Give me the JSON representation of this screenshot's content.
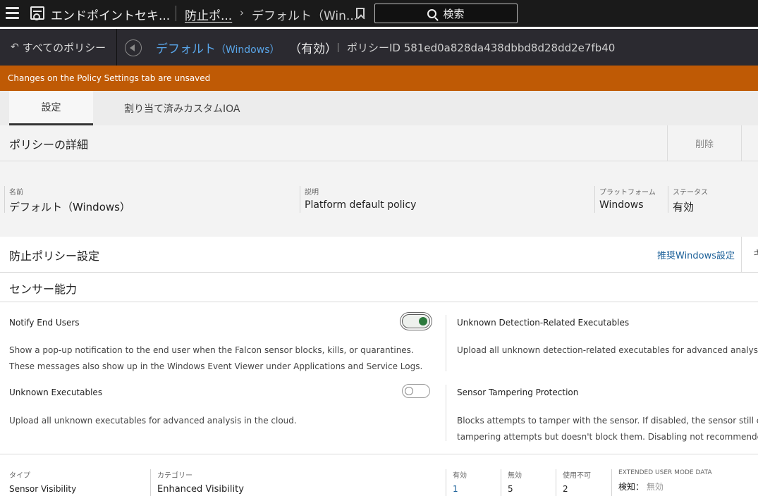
{
  "topbar": {
    "app_title": "エンドポイントセキ...",
    "crumb1": "防止ポ...",
    "crumb_chevron": "›",
    "crumb2": "デフォルト（Win...",
    "search_label": "検索"
  },
  "policy_bar": {
    "back_label": "すべてのポリシー",
    "undo_glyph": "↶",
    "name": "デフォルト",
    "platform": "（Windows）",
    "state": "（有効）",
    "id_label": "ポリシーID 581ed0a828da438dbbd8d28dd2e7fb40"
  },
  "banner": {
    "text": "Changes on the Policy Settings tab are unsaved"
  },
  "tabs": [
    {
      "label": "設定"
    },
    {
      "label": "割り当て済みカスタムIOA"
    }
  ],
  "details": {
    "title": "ポリシーの詳細",
    "delete_label": "削除",
    "fields": {
      "name_label": "名前",
      "name_value": "デフォルト（Windows）",
      "desc_label": "説明",
      "desc_value": "Platform default policy",
      "platform_label": "プラットフォーム",
      "platform_value": "Windows",
      "status_label": "ステータス",
      "status_value": "有効"
    }
  },
  "prevention": {
    "title": "防止ポリシー設定",
    "recommend_link": "推奨Windows設定",
    "extra": "キ"
  },
  "sensor": {
    "title": "センサー能力",
    "settings": [
      {
        "name": "Notify End Users",
        "desc1": "Show a pop-up notification to the end user when the Falcon sensor blocks, kills, or quarantines.",
        "desc2": "These messages also show up in the Windows Event Viewer under Applications and Service Logs.",
        "enabled": true
      },
      {
        "name": "Unknown Detection-Related Executables",
        "desc1": "Upload all unknown detection-related executables for advanced analysis"
      },
      {
        "name": "Unknown Executables",
        "desc1": "Upload all unknown executables for advanced analysis in the cloud.",
        "enabled": false
      },
      {
        "name": "Sensor Tampering Protection",
        "desc1": "Blocks attempts to tamper with the sensor. If disabled, the sensor still c",
        "desc2": "tampering attempts but doesn't block them. Disabling not recommended"
      }
    ]
  },
  "table": {
    "type_label": "タイプ",
    "type_value": "Sensor Visibility",
    "category_label": "カテゴリー",
    "category_value": "Enhanced Visibility",
    "enabled_label": "有効",
    "enabled_value": "1",
    "disabled_label": "無効",
    "disabled_value": "5",
    "unavailable_label": "使用不可",
    "unavailable_value": "2",
    "extended_label": "EXTENDED USER MODE DATA",
    "detect_label": "検知：",
    "detect_value": "無効"
  }
}
